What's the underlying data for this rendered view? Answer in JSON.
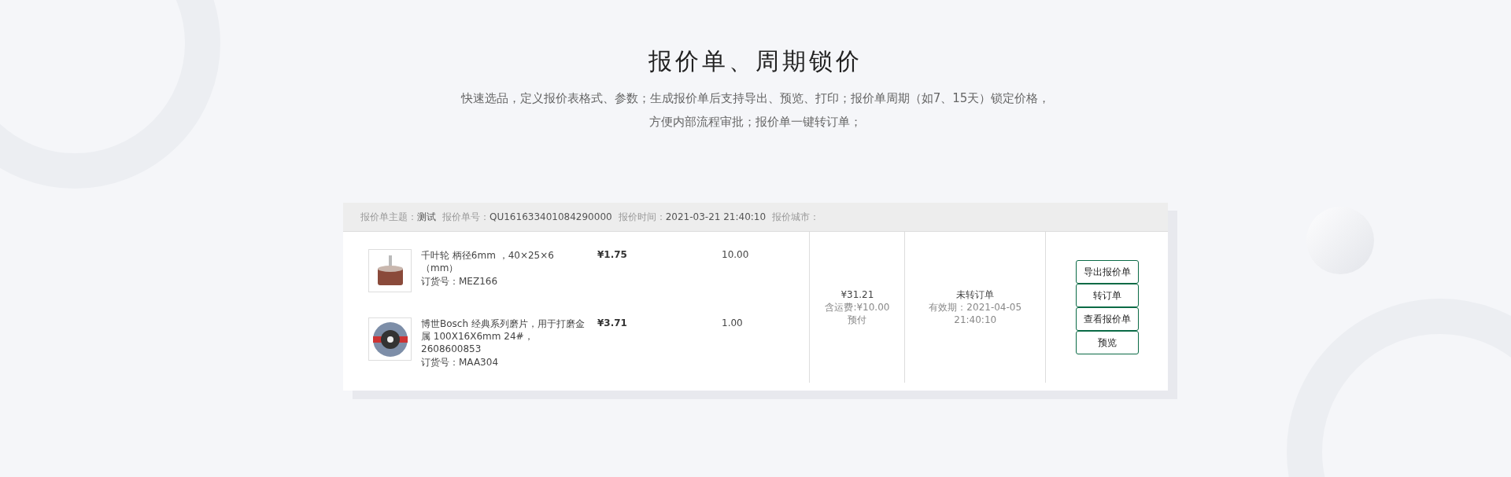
{
  "title": "报价单、周期锁价",
  "description": [
    "快速选品，定义报价表格式、参数；生成报价单后支持导出、预览、打印；报价单周期（如7、15天）锁定价格，",
    "方便内部流程审批；报价单一键转订单；"
  ],
  "quote": {
    "header": [
      {
        "label": "报价单主题：",
        "value": "测试"
      },
      {
        "label": "报价单号：",
        "value": "QU161633401084290000"
      },
      {
        "label": "报价时间：",
        "value": "2021-03-21 21:40:10"
      },
      {
        "label": "报价城市："
      }
    ],
    "items": [
      {
        "kind": "flap-wheel",
        "name": "千叶轮 柄径6mm ，40×25×6（mm）",
        "code": "订货号：MEZ166",
        "price": "¥1.75",
        "quantity": "10.00"
      },
      {
        "kind": "grinding-disc",
        "name": "博世Bosch 经典系列磨片，用于打磨金属 100X16X6mm 24#，2608600853",
        "code": "订货号：MAA304",
        "price": "¥3.71",
        "quantity": "1.00"
      }
    ],
    "total": "¥31.21",
    "shipping": "含运费:¥10.00",
    "payment": "预付",
    "status": "未转订单",
    "valid_until": "有效期：2021-04-05 21:40:10",
    "actions": [
      "导出报价单",
      "转订单",
      "查看报价单",
      "预览"
    ]
  }
}
